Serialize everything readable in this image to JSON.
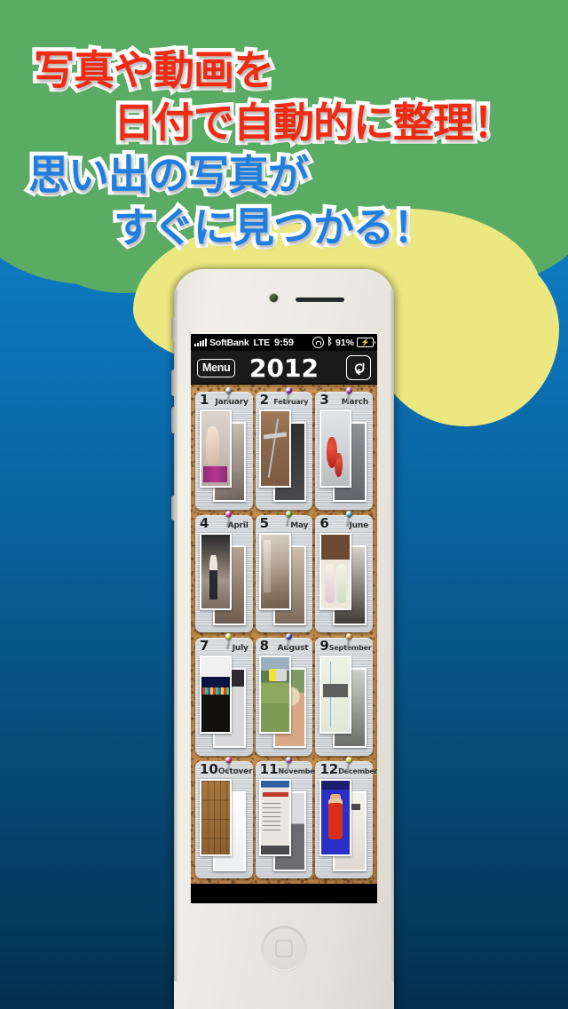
{
  "promo": {
    "lines": [
      {
        "text": "写真や動画を",
        "color": "red"
      },
      {
        "text": "日付で自動的に整理！",
        "color": "red"
      },
      {
        "text": "思い出の写真が",
        "color": "blue"
      },
      {
        "text": "すぐに見つかる！",
        "color": "blue"
      }
    ],
    "colors": {
      "red": "#ef2b12",
      "blue": "#1f7fe0",
      "outline": "#ffffff"
    }
  },
  "background": {
    "gradient_top": "#1186cc",
    "gradient_bottom": "#04395c",
    "blob_green": "#5aab64",
    "blob_yellow": "#ece881"
  },
  "device": {
    "name": "white-smartphone",
    "body_color": "#eceae4",
    "screen_bg": "#000000"
  },
  "status_bar": {
    "signal_icon": "signal-bars-icon",
    "carrier": "SoftBank",
    "network": "LTE",
    "time": "9:59",
    "rotation_lock_icon": "rotation-lock-icon",
    "bluetooth_icon": "bluetooth-icon",
    "bluetooth_glyph": "ᛒ",
    "battery_percent": "91%",
    "battery_icon": "battery-charging-icon",
    "battery_glyph": "⚡"
  },
  "navbar": {
    "menu_label": "Menu",
    "title": "2012",
    "refresh_icon": "rotate-refresh-icon"
  },
  "board": {
    "surface": "cork-board",
    "cork_color": "#c08a4e",
    "months": [
      {
        "number": "1",
        "name": "January",
        "pin_color": "#8f8f96",
        "art": "jan",
        "art2": "jan2"
      },
      {
        "number": "2",
        "name": "February",
        "pin_color": "#8a1fb0",
        "art": "feb",
        "art2": "feb2"
      },
      {
        "number": "3",
        "name": "March",
        "pin_color": "#a81fb8",
        "art": "mar",
        "art2": "mar2"
      },
      {
        "number": "4",
        "name": "April",
        "pin_color": "#d81fa8",
        "art": "apr",
        "art2": "apr2"
      },
      {
        "number": "5",
        "name": "May",
        "pin_color": "#5ec020",
        "art": "may",
        "art2": "may2"
      },
      {
        "number": "6",
        "name": "June",
        "pin_color": "#1fa8d8",
        "art": "jun",
        "art2": "jun2"
      },
      {
        "number": "7",
        "name": "July",
        "pin_color": "#c8d81f",
        "art": "jul",
        "art2": "jul2"
      },
      {
        "number": "8",
        "name": "August",
        "pin_color": "#1f3fd8",
        "art": "aug",
        "art2": "aug2"
      },
      {
        "number": "9",
        "name": "September",
        "pin_color": "#e09020",
        "art": "sep",
        "art2": "sep2"
      },
      {
        "number": "10",
        "name": "Octover",
        "pin_color": "#d81f6a",
        "art": "oct",
        "art2": "oct2"
      },
      {
        "number": "11",
        "name": "November",
        "pin_color": "#9a3fb0",
        "art": "nov",
        "art2": "nov2"
      },
      {
        "number": "12",
        "name": "December",
        "pin_color": "#d8d81f",
        "art": "dec",
        "art2": "dec2"
      }
    ]
  },
  "home_button": {
    "icon": "home-rounded-square-icon"
  }
}
